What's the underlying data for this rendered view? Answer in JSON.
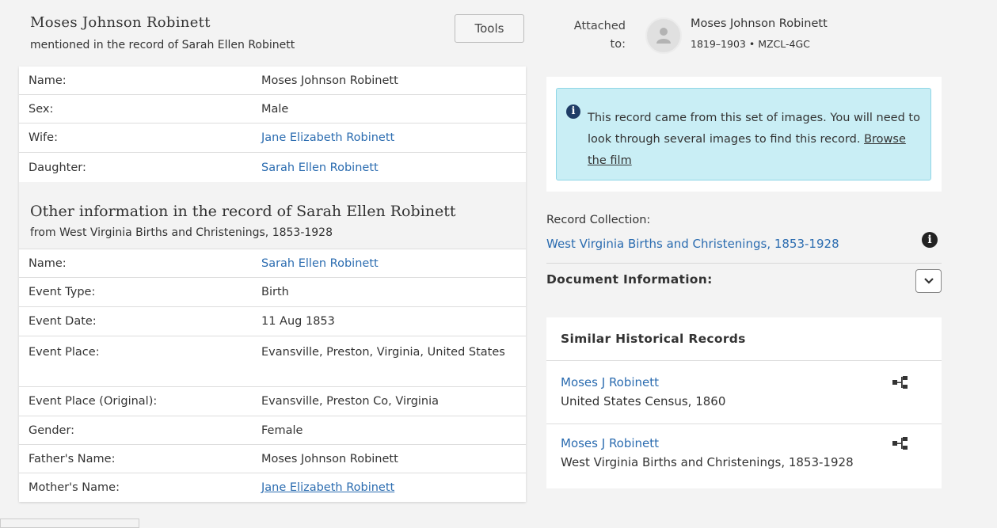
{
  "header": {
    "person_name": "Moses Johnson Robinett",
    "subtitle": "mentioned in the record of Sarah Ellen Robinett",
    "tools_label": "Tools"
  },
  "person_fields": [
    {
      "label": "Name:",
      "value": "Moses Johnson Robinett",
      "link": false
    },
    {
      "label": "Sex:",
      "value": "Male",
      "link": false
    },
    {
      "label": "Wife:",
      "value": "Jane Elizabeth Robinett",
      "link": true
    },
    {
      "label": "Daughter:",
      "value": "Sarah Ellen Robinett",
      "link": true
    }
  ],
  "other_info": {
    "title": "Other information in the record of Sarah Ellen Robinett",
    "subtitle": "from West Virginia Births and Christenings, 1853-1928",
    "fields": [
      {
        "label": "Name:",
        "value": "Sarah Ellen Robinett",
        "link": true
      },
      {
        "label": "Event Type:",
        "value": "Birth",
        "link": false
      },
      {
        "label": "Event Date:",
        "value": "11 Aug 1853",
        "link": false
      },
      {
        "label": "Event Place:",
        "value": "Evansville, Preston, Virginia, United States",
        "link": false
      },
      {
        "label": "Event Place (Original):",
        "value": "Evansville, Preston Co, Virginia",
        "link": false
      },
      {
        "label": "Gender:",
        "value": "Female",
        "link": false
      },
      {
        "label": "Father's Name:",
        "value": "Moses Johnson Robinett",
        "link": false
      },
      {
        "label": "Mother's Name:",
        "value": "Jane Elizabeth Robinett",
        "link": true
      }
    ]
  },
  "attached": {
    "label": "Attached to:",
    "name": "Moses Johnson Robinett",
    "meta": "1819–1903 • MZCL-4GC",
    "avatar_icon": "person-icon"
  },
  "info_box": {
    "text": "This record came from this set of images. You will need to look through several images to find this record.",
    "link": "Browse the film",
    "icon": "info-icon"
  },
  "record_collection": {
    "label": "Record Collection:",
    "link": "West Virginia Births and Christenings, 1853-1928"
  },
  "document_info": {
    "label": "Document Information:",
    "icon": "chevron-down-icon"
  },
  "similar": {
    "title": "Similar Historical Records",
    "items": [
      {
        "name": "Moses J Robinett",
        "collection": "United States Census, 1860",
        "icon": "tree-icon"
      },
      {
        "name": "Moses J Robinett",
        "collection": "West Virginia Births and Christenings, 1853-1928",
        "icon": "tree-icon"
      }
    ]
  },
  "colors": {
    "link": "#2b6cb0",
    "info_bg": "#c9eef5",
    "info_border": "#8fd6e6",
    "page_bg": "#f3f3f3"
  }
}
